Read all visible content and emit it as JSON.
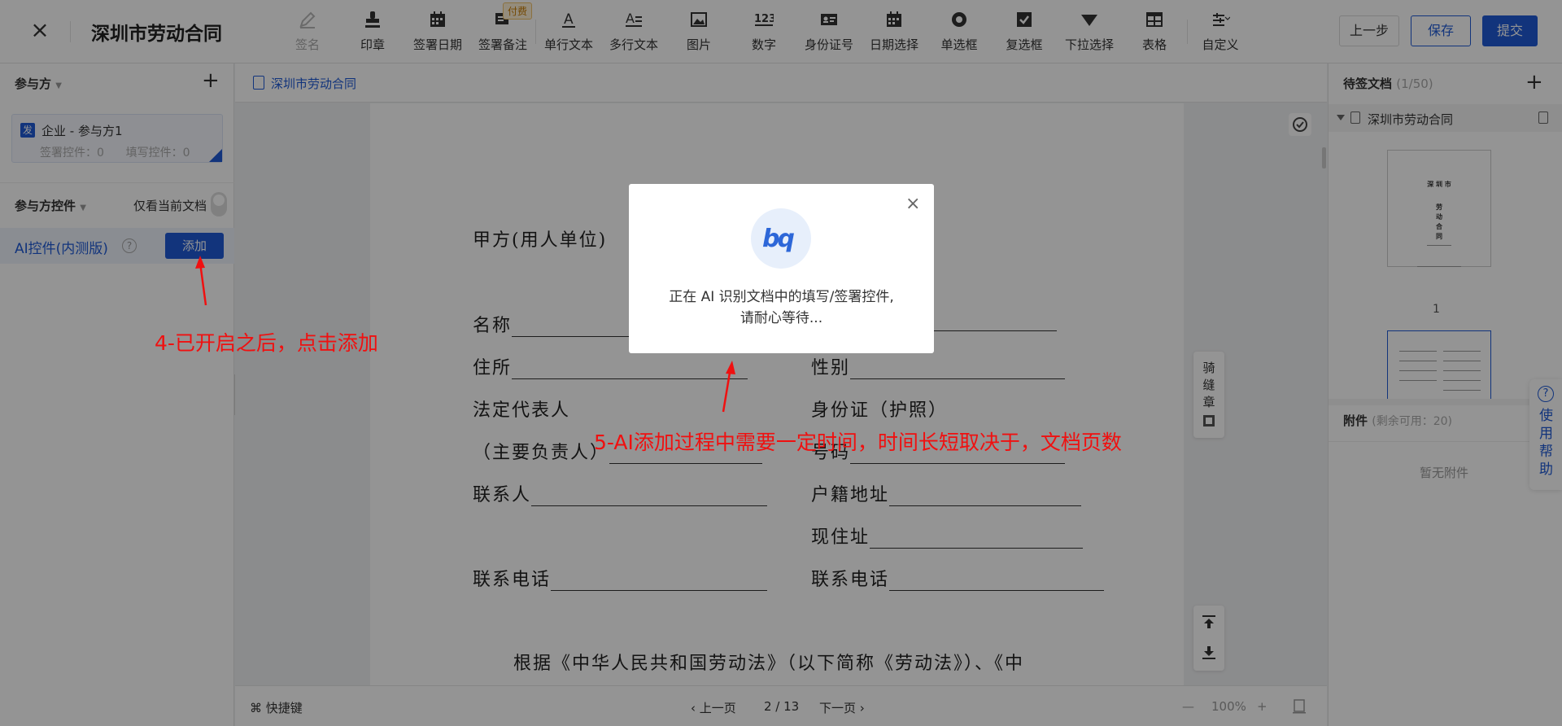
{
  "header": {
    "title": "深圳市劳动合同",
    "close_icon": "close-icon"
  },
  "toolbar": {
    "tools": [
      {
        "label": "签名",
        "icon": "pen-icon",
        "disabled": true
      },
      {
        "label": "印章",
        "icon": "stamp-icon"
      },
      {
        "label": "签署日期",
        "icon": "calendar-icon"
      },
      {
        "label": "签署备注",
        "icon": "note-icon",
        "badge": "付费"
      },
      {
        "label": "单行文本",
        "icon": "single-text-icon"
      },
      {
        "label": "多行文本",
        "icon": "multi-text-icon"
      },
      {
        "label": "图片",
        "icon": "image-icon"
      },
      {
        "label": "数字",
        "icon": "number-icon",
        "glyph": "123"
      },
      {
        "label": "身份证号",
        "icon": "id-card-icon"
      },
      {
        "label": "日期选择",
        "icon": "date-picker-icon"
      },
      {
        "label": "单选框",
        "icon": "radio-icon"
      },
      {
        "label": "复选框",
        "icon": "checkbox-icon"
      },
      {
        "label": "下拉选择",
        "icon": "dropdown-icon"
      },
      {
        "label": "表格",
        "icon": "table-icon"
      },
      {
        "label": "自定义",
        "icon": "custom-icon"
      }
    ],
    "prev_label": "上一步",
    "save_label": "保存",
    "submit_label": "提交"
  },
  "left": {
    "participants_label": "参与方",
    "party": {
      "tag": "发",
      "name": "企业 - 参与方1",
      "sign_controls": "签署控件：0",
      "fill_controls": "填写控件：0"
    },
    "controls_label": "参与方控件",
    "only_current_label": "仅看当前文档",
    "ai_label": "AI控件(内测版)",
    "ai_help": "?",
    "add_label": "添加"
  },
  "center": {
    "file_name": "深圳市劳动合同",
    "doc": {
      "party_a": "甲方(用人单位)",
      "name": "名称",
      "address": "住所",
      "gender": "性别",
      "legal_rep": "法定代表人",
      "id_passport": "身份证（护照）",
      "principal": "（主要负责人）",
      "number": "号码",
      "contact": "联系人",
      "hukou": "户籍地址",
      "current_addr": "现住址",
      "phone_a": "联系电话",
      "phone_b": "联系电话",
      "law_line": "根据《中华人民共和国劳动法》（以下简称《劳动法》）、《中"
    },
    "seal_tab": "骑缝章",
    "shortcuts": "快捷键",
    "prev_page": "上一页",
    "page_indicator": "2 / 13",
    "next_page": "下一页",
    "zoom": "100%",
    "zoom_minus": "—",
    "zoom_plus": "+"
  },
  "right": {
    "pending_label": "待签文档",
    "pending_count": "(1/50)",
    "doc_name": "深圳市劳动合同",
    "page1_num": "1",
    "attachments_label": "附件",
    "attachments_sub": "(剩余可用：20)",
    "no_attachments": "暂无附件",
    "help": "使用帮助",
    "thumb1": {
      "city": "深 圳 市",
      "chars": [
        "劳",
        "动",
        "合",
        "同"
      ]
    }
  },
  "modal": {
    "line1": "正在 AI 识别文档中的填写/签署控件,",
    "line2": "请耐心等待..."
  },
  "annotations": {
    "a4": "4-已开启之后，点击添加",
    "a5": "5-AI添加过程中需要一定时间，时间长短取决于，文档页数"
  },
  "colors": {
    "primary": "#1f5bd6",
    "annotation": "#f01010"
  }
}
